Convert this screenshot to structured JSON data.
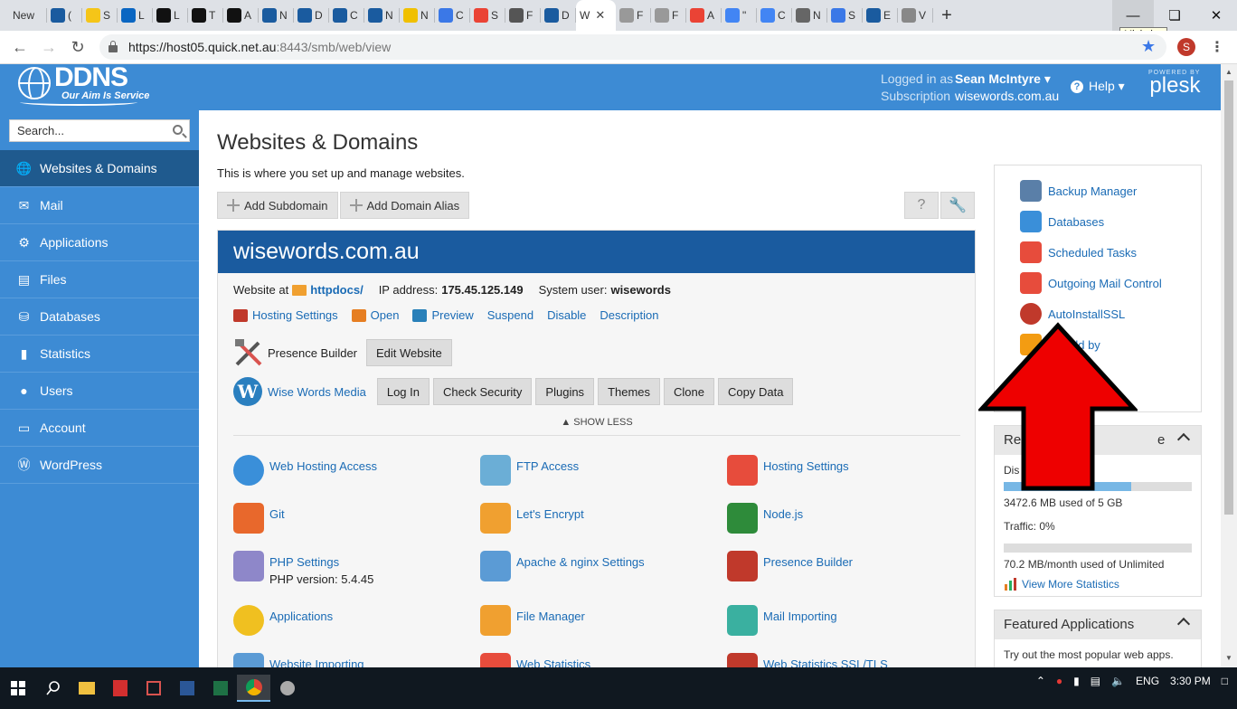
{
  "browser": {
    "tabs": [
      {
        "label": "New",
        "color": "#dee1e6"
      },
      {
        "label": "(",
        "color": "#1a5b9f"
      },
      {
        "label": "S",
        "color": "#f5c518"
      },
      {
        "label": "L",
        "color": "#0a66c2"
      },
      {
        "label": "L",
        "color": "#111111"
      },
      {
        "label": "T",
        "color": "#111111"
      },
      {
        "label": "A",
        "color": "#111111"
      },
      {
        "label": "N",
        "color": "#1a5b9f"
      },
      {
        "label": "D",
        "color": "#1a5b9f"
      },
      {
        "label": "C",
        "color": "#1a5b9f"
      },
      {
        "label": "N",
        "color": "#1a5b9f"
      },
      {
        "label": "N",
        "color": "#f0c000"
      },
      {
        "label": "C",
        "color": "#3b78e7"
      },
      {
        "label": "S",
        "color": "#ea4335"
      },
      {
        "label": "F",
        "color": "#555555"
      },
      {
        "label": "D",
        "color": "#1a5b9f"
      }
    ],
    "active_tab": {
      "label": "W"
    },
    "tabs_after": [
      {
        "label": "F",
        "color": "#999999"
      },
      {
        "label": "F",
        "color": "#999999"
      },
      {
        "label": "A",
        "color": "#ea4335"
      },
      {
        "label": "\"",
        "color": "#4285f4"
      },
      {
        "label": "C",
        "color": "#4285f4"
      },
      {
        "label": "N",
        "color": "#666666"
      },
      {
        "label": "S",
        "color": "#3b78e7"
      },
      {
        "label": "E",
        "color": "#1a5b9f"
      },
      {
        "label": "V",
        "color": "#888888"
      }
    ],
    "tooltip": "Minimize",
    "url_host": "https://host05.quick.net.au",
    "url_rest": ":8443/smb/web/view",
    "profile_initial": "S"
  },
  "header": {
    "logo_big": "DDNS",
    "logo_small": "Our Aim Is Service",
    "logged_label": "Logged in as",
    "logged_user": "Sean McIntyre ▾",
    "sub_label": "Subscription",
    "sub_value": "wisewords.com.au",
    "help": "Help ▾",
    "powered": "POWERED BY",
    "plesk": "plesk"
  },
  "sidebar": {
    "search_placeholder": "Search...",
    "items": [
      {
        "label": "Websites & Domains",
        "icon": "globe-icon"
      },
      {
        "label": "Mail",
        "icon": "mail-icon"
      },
      {
        "label": "Applications",
        "icon": "gear-icon"
      },
      {
        "label": "Files",
        "icon": "file-icon"
      },
      {
        "label": "Databases",
        "icon": "database-icon"
      },
      {
        "label": "Statistics",
        "icon": "bar-chart-icon"
      },
      {
        "label": "Users",
        "icon": "user-icon"
      },
      {
        "label": "Account",
        "icon": "card-icon"
      },
      {
        "label": "WordPress",
        "icon": "wordpress-icon"
      }
    ]
  },
  "main": {
    "title": "Websites & Domains",
    "description": "This is where you set up and manage websites.",
    "add_subdomain": "Add Subdomain",
    "add_alias": "Add Domain Alias",
    "domain": "wisewords.com.au",
    "website_at": "Website at",
    "httpdocs": "httpdocs/",
    "ip_label": "IP address:",
    "ip_value": "175.45.125.149",
    "sysuser_label": "System user:",
    "sysuser_value": "wisewords",
    "links": [
      "Hosting Settings",
      "Open",
      "Preview",
      "Suspend",
      "Disable",
      "Description"
    ],
    "presence_builder": "Presence Builder",
    "edit_website": "Edit Website",
    "wp_site": "Wise Words Media",
    "wp_buttons": [
      "Log In",
      "Check Security",
      "Plugins",
      "Themes",
      "Clone",
      "Copy Data"
    ],
    "show_less": "SHOW LESS",
    "tools": [
      {
        "label": "Web Hosting Access",
        "sub": ""
      },
      {
        "label": "FTP Access",
        "sub": ""
      },
      {
        "label": "Hosting Settings",
        "sub": ""
      },
      {
        "label": "Git",
        "sub": ""
      },
      {
        "label": "Let's Encrypt",
        "sub": ""
      },
      {
        "label": "Node.js",
        "sub": ""
      },
      {
        "label": "PHP Settings",
        "sub": "PHP version: 5.4.45"
      },
      {
        "label": "Apache & nginx Settings",
        "sub": ""
      },
      {
        "label": "Presence Builder",
        "sub": ""
      },
      {
        "label": "Applications",
        "sub": ""
      },
      {
        "label": "File Manager",
        "sub": ""
      },
      {
        "label": "Mail Importing",
        "sub": ""
      },
      {
        "label": "Website Importing",
        "sub": ""
      },
      {
        "label": "Web Statistics",
        "sub": ""
      },
      {
        "label": "Web Statistics SSL/TLS",
        "sub": ""
      }
    ]
  },
  "right": {
    "items": [
      {
        "label": "Backup Manager"
      },
      {
        "label": "Databases"
      },
      {
        "label": "Scheduled Tasks"
      },
      {
        "label": "Outgoing Mail Control"
      },
      {
        "label": "AutoInstallSSL"
      },
      {
        "label": "rShield by"
      },
      {
        "label": "re"
      }
    ],
    "resources_head_left": "Re",
    "resources_head_right": "e",
    "disk_label": "Dis",
    "disk_usage": "3472.6 MB used of 5 GB",
    "disk_fraction": 0.68,
    "traffic_label": "Traffic: 0%",
    "traffic_usage": "70.2 MB/month used of Unlimited",
    "traffic_fraction": 0.0,
    "view_stats": "View More Statistics",
    "featured_head": "Featured Applications",
    "featured_text": "Try out the most popular web apps."
  },
  "taskbar": {
    "lang": "ENG",
    "time": "3:30 PM"
  }
}
